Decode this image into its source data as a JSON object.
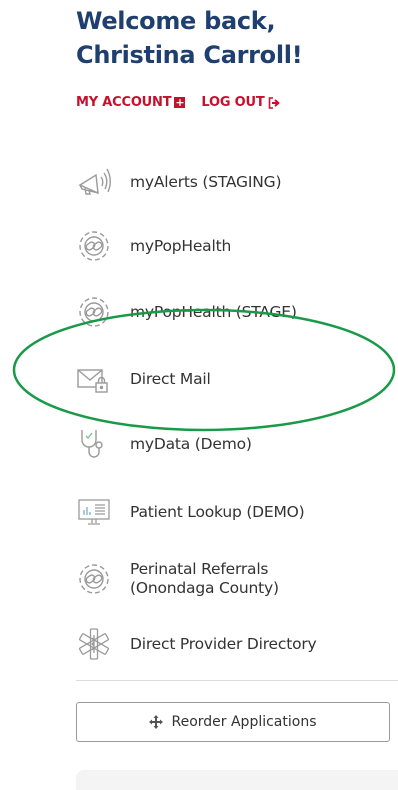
{
  "welcome": {
    "line1": "Welcome back,",
    "line2": "Christina Carroll!"
  },
  "account": {
    "my_account": "MY ACCOUNT",
    "log_out": "LOG OUT",
    "my_account_icon": "plus-square-icon",
    "log_out_icon": "sign-out-icon"
  },
  "apps": [
    {
      "label": "myAlerts (STAGING)",
      "icon": "megaphone-icon"
    },
    {
      "label": "myPopHealth",
      "icon": "link-chain-icon"
    },
    {
      "label": "myPopHealth (STAGE)",
      "icon": "link-chain-icon"
    },
    {
      "label": "Direct Mail",
      "icon": "mail-lock-icon"
    },
    {
      "label": "myData (Demo)",
      "icon": "stethoscope-icon"
    },
    {
      "label": "Patient Lookup (DEMO)",
      "icon": "monitor-icon"
    },
    {
      "label": "Perinatal Referrals (Onondaga County)",
      "line1": "Perinatal Referrals",
      "line2": "(Onondaga County)",
      "icon": "link-chain-icon"
    },
    {
      "label": "Direct Provider Directory",
      "icon": "star-of-life-icon"
    }
  ],
  "reorder_button": {
    "label": "Reorder Applications",
    "icon": "move-arrows-icon"
  },
  "colors": {
    "title": "#1f3f6e",
    "accent": "#c8102e",
    "highlight": "#1a9a48"
  }
}
